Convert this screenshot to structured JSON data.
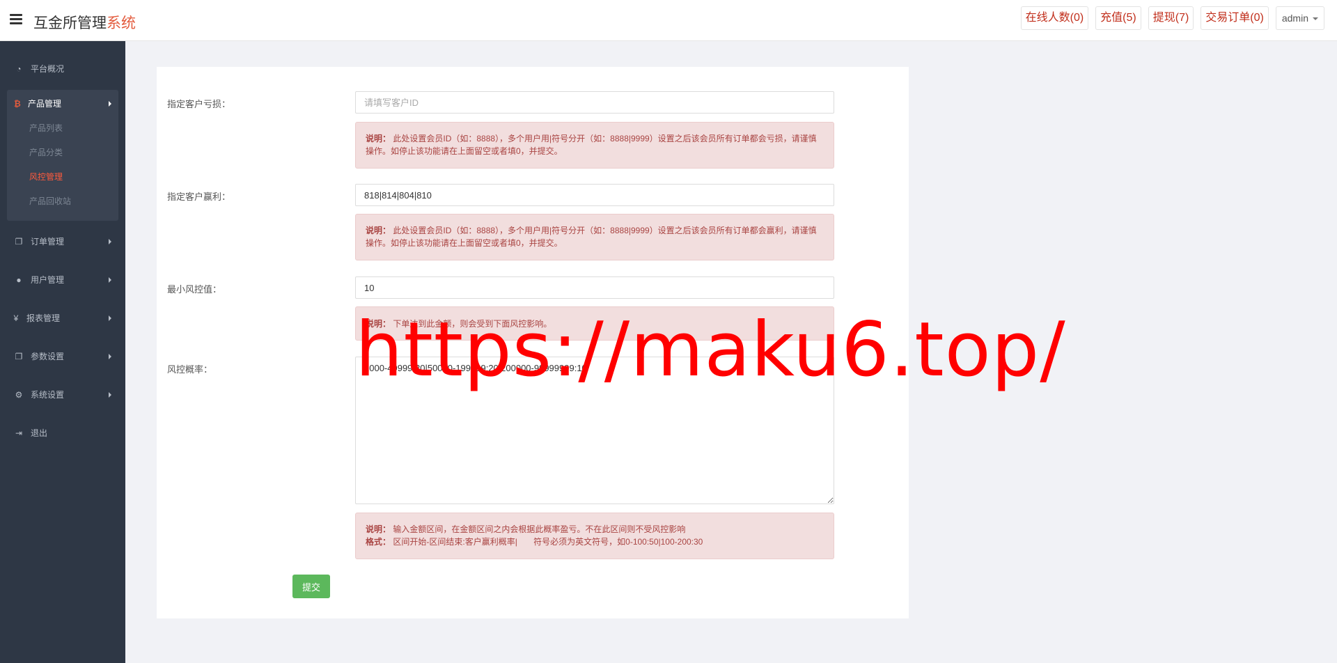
{
  "header": {
    "brand_main": "互金所管理",
    "brand_accent": "系统",
    "online": "在线人数(0)",
    "recharge": "充值(5)",
    "withdraw": "提现(7)",
    "orders": "交易订单(0)",
    "user": "admin"
  },
  "sidebar": {
    "overview": "平台概况",
    "product_mgmt": "产品管理",
    "product_list": "产品列表",
    "product_category": "产品分类",
    "risk_control": "风控管理",
    "product_recycle": "产品回收站",
    "order_mgmt": "订单管理",
    "user_mgmt": "用户管理",
    "report_mgmt": "报表管理",
    "param_settings": "参数设置",
    "system_settings": "系统设置",
    "logout": "退出"
  },
  "form": {
    "loss_label": "指定客户亏损：",
    "loss_placeholder": "请填写客户ID",
    "loss_note_title": "说明：",
    "loss_note": "此处设置会员ID（如：8888），多个用户用|符号分开（如：8888|9999）设置之后该会员所有订单都会亏损，请谨慎操作。如停止该功能请在上面留空或者填0，并提交。",
    "win_label": "指定客户赢利：",
    "win_value": "818|814|804|810",
    "win_note_title": "说明：",
    "win_note": "此处设置会员ID（如：8888），多个用户用|符号分开（如：8888|9999）设置之后该会员所有订单都会赢利，请谨慎操作。如停止该功能请在上面留空或者填0，并提交。",
    "min_label": "最小风控值：",
    "min_value": "10",
    "min_note_title": "说明：",
    "min_note": "下单达到此金额，则会受到下面风控影响。",
    "prob_label": "风控概率：",
    "prob_value": "1000-49999:30|50000-199999:20|200000-99999999:10",
    "prob_note_title": "说明：",
    "prob_note": "输入金额区间，在金额区间之内会根据此概率盈亏。不在此区间则不受风控影响",
    "prob_format_title": "格式：",
    "prob_format": "区间开始-区间结束:客户赢利概率|       符号必须为英文符号，如0-100:50|100-200:30",
    "submit": "提交"
  },
  "watermark": "https://maku6.top/"
}
